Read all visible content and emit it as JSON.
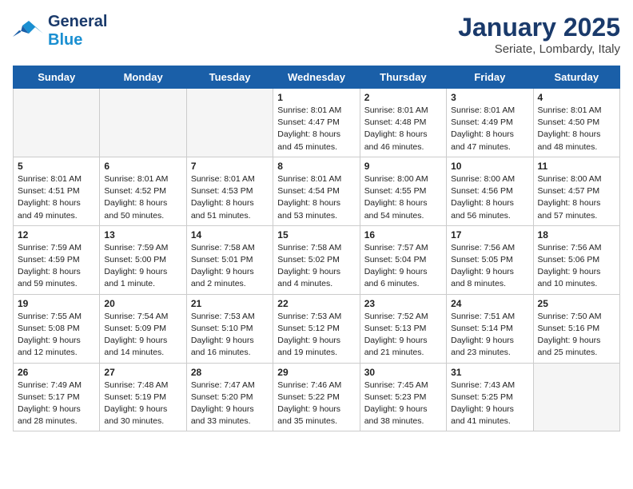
{
  "header": {
    "logo_text_general": "General",
    "logo_text_blue": "Blue",
    "title": "January 2025",
    "subtitle": "Seriate, Lombardy, Italy"
  },
  "calendar": {
    "days_of_week": [
      "Sunday",
      "Monday",
      "Tuesday",
      "Wednesday",
      "Thursday",
      "Friday",
      "Saturday"
    ],
    "weeks": [
      [
        {
          "day": "",
          "info": "",
          "empty": true
        },
        {
          "day": "",
          "info": "",
          "empty": true
        },
        {
          "day": "",
          "info": "",
          "empty": true
        },
        {
          "day": "1",
          "info": "Sunrise: 8:01 AM\nSunset: 4:47 PM\nDaylight: 8 hours\nand 45 minutes.",
          "empty": false
        },
        {
          "day": "2",
          "info": "Sunrise: 8:01 AM\nSunset: 4:48 PM\nDaylight: 8 hours\nand 46 minutes.",
          "empty": false
        },
        {
          "day": "3",
          "info": "Sunrise: 8:01 AM\nSunset: 4:49 PM\nDaylight: 8 hours\nand 47 minutes.",
          "empty": false
        },
        {
          "day": "4",
          "info": "Sunrise: 8:01 AM\nSunset: 4:50 PM\nDaylight: 8 hours\nand 48 minutes.",
          "empty": false
        }
      ],
      [
        {
          "day": "5",
          "info": "Sunrise: 8:01 AM\nSunset: 4:51 PM\nDaylight: 8 hours\nand 49 minutes.",
          "empty": false
        },
        {
          "day": "6",
          "info": "Sunrise: 8:01 AM\nSunset: 4:52 PM\nDaylight: 8 hours\nand 50 minutes.",
          "empty": false
        },
        {
          "day": "7",
          "info": "Sunrise: 8:01 AM\nSunset: 4:53 PM\nDaylight: 8 hours\nand 51 minutes.",
          "empty": false
        },
        {
          "day": "8",
          "info": "Sunrise: 8:01 AM\nSunset: 4:54 PM\nDaylight: 8 hours\nand 53 minutes.",
          "empty": false
        },
        {
          "day": "9",
          "info": "Sunrise: 8:00 AM\nSunset: 4:55 PM\nDaylight: 8 hours\nand 54 minutes.",
          "empty": false
        },
        {
          "day": "10",
          "info": "Sunrise: 8:00 AM\nSunset: 4:56 PM\nDaylight: 8 hours\nand 56 minutes.",
          "empty": false
        },
        {
          "day": "11",
          "info": "Sunrise: 8:00 AM\nSunset: 4:57 PM\nDaylight: 8 hours\nand 57 minutes.",
          "empty": false
        }
      ],
      [
        {
          "day": "12",
          "info": "Sunrise: 7:59 AM\nSunset: 4:59 PM\nDaylight: 8 hours\nand 59 minutes.",
          "empty": false
        },
        {
          "day": "13",
          "info": "Sunrise: 7:59 AM\nSunset: 5:00 PM\nDaylight: 9 hours\nand 1 minute.",
          "empty": false
        },
        {
          "day": "14",
          "info": "Sunrise: 7:58 AM\nSunset: 5:01 PM\nDaylight: 9 hours\nand 2 minutes.",
          "empty": false
        },
        {
          "day": "15",
          "info": "Sunrise: 7:58 AM\nSunset: 5:02 PM\nDaylight: 9 hours\nand 4 minutes.",
          "empty": false
        },
        {
          "day": "16",
          "info": "Sunrise: 7:57 AM\nSunset: 5:04 PM\nDaylight: 9 hours\nand 6 minutes.",
          "empty": false
        },
        {
          "day": "17",
          "info": "Sunrise: 7:56 AM\nSunset: 5:05 PM\nDaylight: 9 hours\nand 8 minutes.",
          "empty": false
        },
        {
          "day": "18",
          "info": "Sunrise: 7:56 AM\nSunset: 5:06 PM\nDaylight: 9 hours\nand 10 minutes.",
          "empty": false
        }
      ],
      [
        {
          "day": "19",
          "info": "Sunrise: 7:55 AM\nSunset: 5:08 PM\nDaylight: 9 hours\nand 12 minutes.",
          "empty": false
        },
        {
          "day": "20",
          "info": "Sunrise: 7:54 AM\nSunset: 5:09 PM\nDaylight: 9 hours\nand 14 minutes.",
          "empty": false
        },
        {
          "day": "21",
          "info": "Sunrise: 7:53 AM\nSunset: 5:10 PM\nDaylight: 9 hours\nand 16 minutes.",
          "empty": false
        },
        {
          "day": "22",
          "info": "Sunrise: 7:53 AM\nSunset: 5:12 PM\nDaylight: 9 hours\nand 19 minutes.",
          "empty": false
        },
        {
          "day": "23",
          "info": "Sunrise: 7:52 AM\nSunset: 5:13 PM\nDaylight: 9 hours\nand 21 minutes.",
          "empty": false
        },
        {
          "day": "24",
          "info": "Sunrise: 7:51 AM\nSunset: 5:14 PM\nDaylight: 9 hours\nand 23 minutes.",
          "empty": false
        },
        {
          "day": "25",
          "info": "Sunrise: 7:50 AM\nSunset: 5:16 PM\nDaylight: 9 hours\nand 25 minutes.",
          "empty": false
        }
      ],
      [
        {
          "day": "26",
          "info": "Sunrise: 7:49 AM\nSunset: 5:17 PM\nDaylight: 9 hours\nand 28 minutes.",
          "empty": false
        },
        {
          "day": "27",
          "info": "Sunrise: 7:48 AM\nSunset: 5:19 PM\nDaylight: 9 hours\nand 30 minutes.",
          "empty": false
        },
        {
          "day": "28",
          "info": "Sunrise: 7:47 AM\nSunset: 5:20 PM\nDaylight: 9 hours\nand 33 minutes.",
          "empty": false
        },
        {
          "day": "29",
          "info": "Sunrise: 7:46 AM\nSunset: 5:22 PM\nDaylight: 9 hours\nand 35 minutes.",
          "empty": false
        },
        {
          "day": "30",
          "info": "Sunrise: 7:45 AM\nSunset: 5:23 PM\nDaylight: 9 hours\nand 38 minutes.",
          "empty": false
        },
        {
          "day": "31",
          "info": "Sunrise: 7:43 AM\nSunset: 5:25 PM\nDaylight: 9 hours\nand 41 minutes.",
          "empty": false
        },
        {
          "day": "",
          "info": "",
          "empty": true
        }
      ]
    ]
  }
}
